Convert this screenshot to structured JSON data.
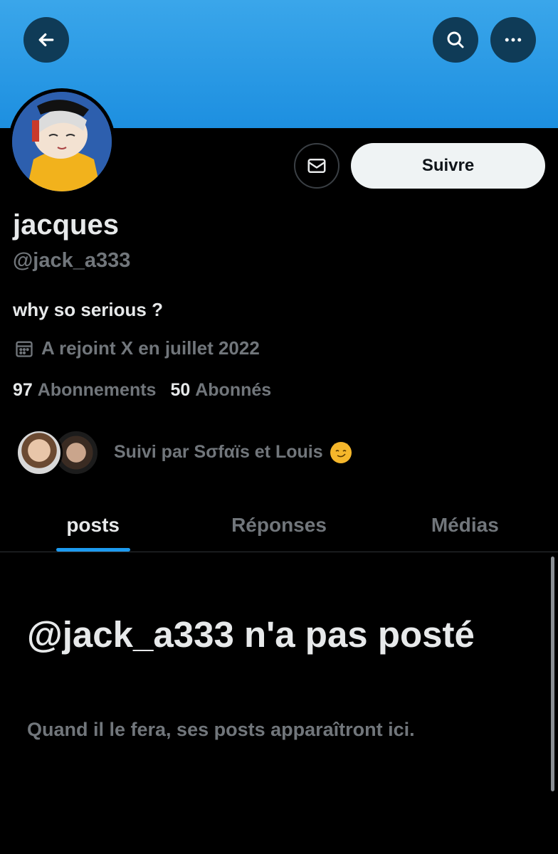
{
  "profile": {
    "name": "jacques",
    "handle": "@jack_a333",
    "bio": "why so serious ?",
    "joined": "A rejoint X en juillet 2022",
    "following_count": "97",
    "following_label": "Abonnements",
    "followers_count": "50",
    "followers_label": "Abonnés",
    "followed_by": "Suivi par Sσfαïs et Louis"
  },
  "actions": {
    "follow_label": "Suivre"
  },
  "tabs": [
    {
      "label": "posts",
      "active": true
    },
    {
      "label": "Réponses",
      "active": false
    },
    {
      "label": "Médias",
      "active": false
    }
  ],
  "empty_state": {
    "title": "@jack_a333 n'a pas posté",
    "subtitle": "Quand il le fera, ses posts apparaîtront ici."
  },
  "icons": {
    "back": "arrow-left-icon",
    "search": "search-icon",
    "more": "more-icon",
    "message": "envelope-icon",
    "calendar": "calendar-icon"
  },
  "colors": {
    "accent": "#1d9bf0",
    "banner": "#1d8fe0",
    "muted": "#71767b"
  }
}
